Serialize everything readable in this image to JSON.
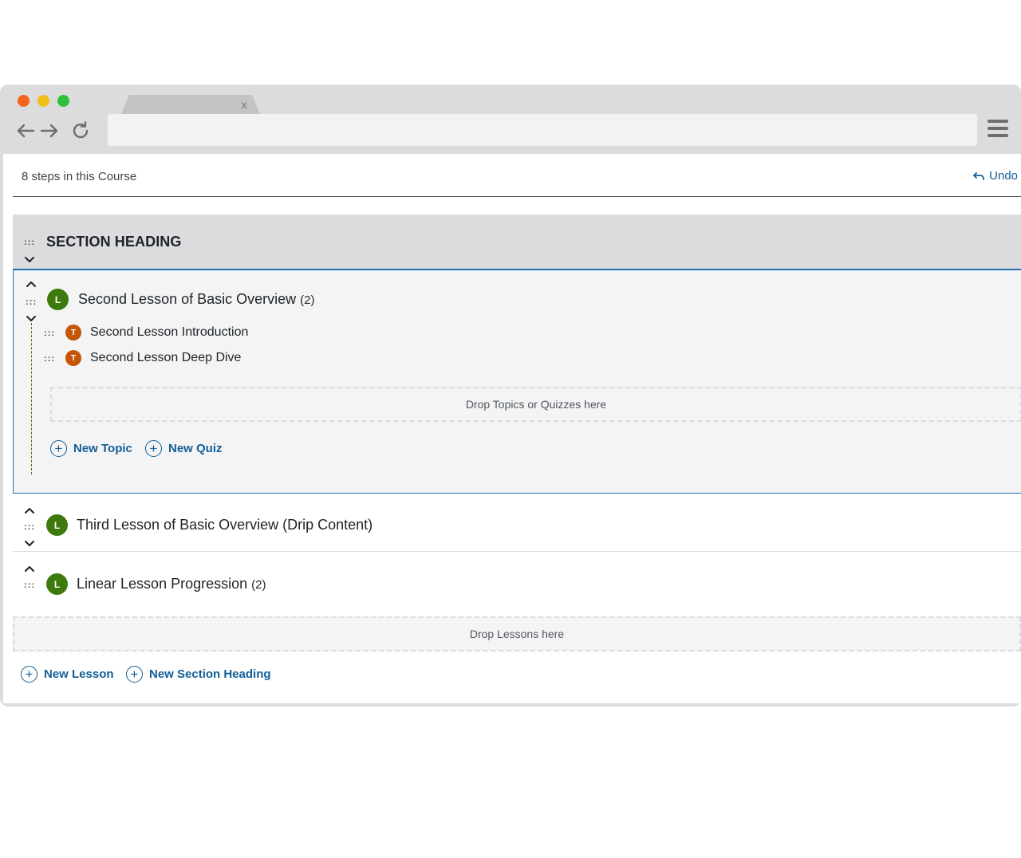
{
  "browser": {
    "tab_close": "x",
    "icons": {
      "back": "arrow-left-icon",
      "forward": "arrow-right-icon",
      "reload": "reload-icon",
      "menu": "hamburger-menu-icon"
    }
  },
  "header": {
    "steps_count": "8 steps in this Course",
    "undo_label": "Undo"
  },
  "section": {
    "title": "SECTION HEADING"
  },
  "lessons": [
    {
      "badge": "L",
      "title": "Second Lesson of Basic Overview",
      "count": "(2)",
      "topics": [
        {
          "badge": "T",
          "title": "Second Lesson Introduction"
        },
        {
          "badge": "T",
          "title": "Second Lesson Deep Dive"
        }
      ],
      "drop_text": "Drop Topics or Quizzes here",
      "new_topic_label": "New Topic",
      "new_quiz_label": "New Quiz"
    },
    {
      "badge": "L",
      "title": "Third Lesson of Basic Overview (Drip Content)"
    },
    {
      "badge": "L",
      "title": "Linear Lesson Progression",
      "count": "(2)"
    }
  ],
  "footer": {
    "drop_lessons_text": "Drop Lessons here",
    "new_lesson_label": "New Lesson",
    "new_section_heading_label": "New Section Heading",
    "plus_symbol": "+"
  },
  "colors": {
    "lesson_badge": "#3d7a0e",
    "topic_badge": "#c45508",
    "link": "#135e96",
    "accent_border": "#2271b1"
  }
}
